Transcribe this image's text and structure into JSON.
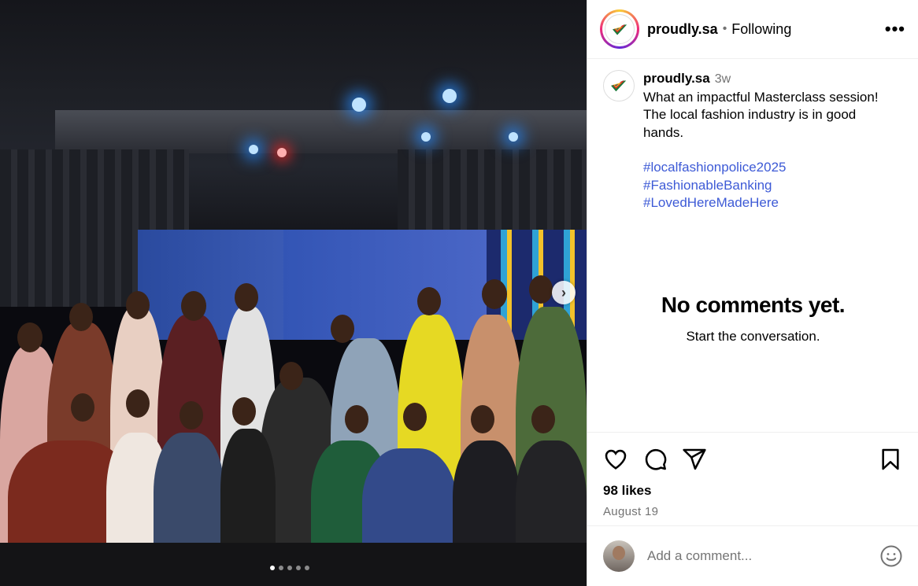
{
  "header": {
    "username": "proudly.sa",
    "separator": "•",
    "follow_status": "Following",
    "more_label": "•••"
  },
  "caption": {
    "username": "proudly.sa",
    "time_ago": "3w",
    "text": "What an impactful Masterclass session! The local fashion industry is in good hands.",
    "hashtags": [
      "#localfashionpolice2025",
      "#FashionableBanking",
      "#LovedHereMadeHere"
    ]
  },
  "empty_state": {
    "title": "No comments yet.",
    "subtitle": "Start the conversation."
  },
  "actions": {
    "likes": "98 likes",
    "date": "August 19"
  },
  "comment_bar": {
    "placeholder": "Add a comment..."
  },
  "carousel": {
    "next_label": "›",
    "slides": 5,
    "active": 1
  },
  "icons": [
    "heart-icon",
    "comment-icon",
    "share-icon",
    "bookmark-icon",
    "emoji-icon",
    "more-icon",
    "chevron-right-icon"
  ],
  "colors": {
    "hashtag": "#3d5ad6",
    "muted": "#737373"
  }
}
